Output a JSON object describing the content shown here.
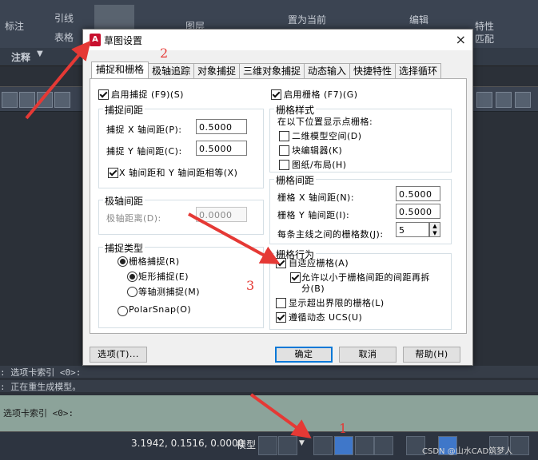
{
  "ribbon": {
    "left_items": [
      "标注",
      "引线",
      "表格"
    ],
    "mid_items": [
      "图层",
      "置为当前"
    ],
    "right_items": [
      "编辑",
      "特性",
      "匹配"
    ],
    "tab_label": "注释"
  },
  "command": {
    "line1": ": 选项卡索引 <0>:",
    "line2": ": 正在重生成模型。",
    "prompt": "选项卡索引 <0>:"
  },
  "status": {
    "coords": "3.1942, 0.1516, 0.0000",
    "model": "模型",
    "watermark": "CSDN @山水CAD筑梦人"
  },
  "dialog": {
    "title": "草图设置",
    "close": "×",
    "tabs": [
      "捕捉和栅格",
      "极轴追踪",
      "对象捕捉",
      "三维对象捕捉",
      "动态输入",
      "快捷特性",
      "选择循环"
    ],
    "snap_on": "启用捕捉 (F9)(S)",
    "snap_spacing": {
      "title": "捕捉间距",
      "x_label": "捕捉 X 轴间距(P):",
      "x_value": "0.5000",
      "y_label": "捕捉 Y 轴间距(C):",
      "y_value": "0.5000",
      "equal_label": "X 轴间距和 Y 轴间距相等(X)"
    },
    "polar_spacing": {
      "title": "极轴间距",
      "label": "极轴距离(D):",
      "value": "0.0000"
    },
    "snap_type": {
      "title": "捕捉类型",
      "grid_snap": "栅格捕捉(R)",
      "rect_snap": "矩形捕捉(E)",
      "iso_snap": "等轴测捕捉(M)",
      "polar_snap": "PolarSnap(O)"
    },
    "grid_on": "启用栅格 (F7)(G)",
    "grid_style": {
      "title": "栅格样式",
      "desc": "在以下位置显示点栅格:",
      "model_2d": "二维模型空间(D)",
      "block_editor": "块编辑器(K)",
      "sheet_layout": "图纸/布局(H)"
    },
    "grid_spacing": {
      "title": "栅格间距",
      "x_label": "栅格 X 轴间距(N):",
      "x_value": "0.5000",
      "y_label": "栅格 Y 轴间距(I):",
      "y_value": "0.5000",
      "major_label": "每条主线之间的栅格数(J):",
      "major_value": "5"
    },
    "grid_behavior": {
      "title": "栅格行为",
      "adaptive": "自适应栅格(A)",
      "allow_sub_line1": "允许以小于栅格间距的间距再拆",
      "allow_sub_line2": "分(B)",
      "beyond_limits": "显示超出界限的栅格(L)",
      "follow_ucs": "遵循动态 UCS(U)"
    },
    "buttons": {
      "options": "选项(T)...",
      "ok": "确定",
      "cancel": "取消",
      "help": "帮助(H)"
    }
  },
  "annotations": [
    "2",
    "3",
    "1"
  ],
  "colors": {
    "accent": "#0078d7",
    "arrow": "#e53935",
    "brand": "#c8102e"
  }
}
